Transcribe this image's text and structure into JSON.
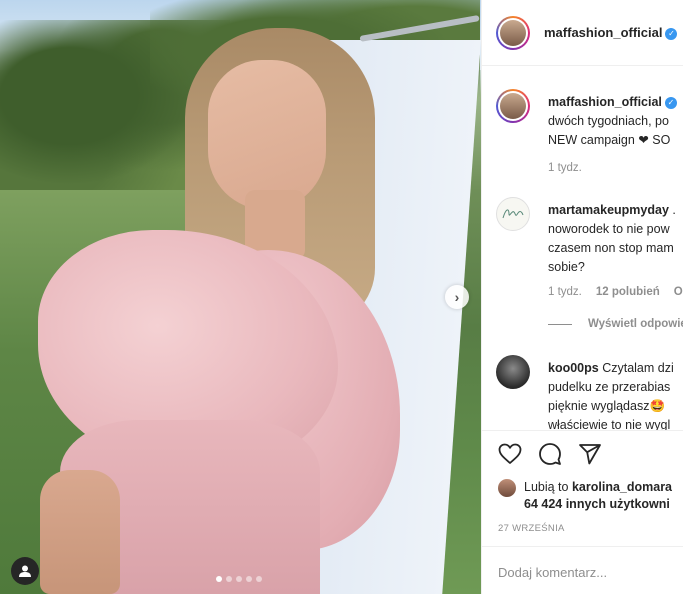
{
  "post": {
    "image_alt": "Woman in pink ruffled dress",
    "carousel_dots": 5,
    "active_dot": 0,
    "next_symbol": "›"
  },
  "header": {
    "username": "maffashion_official",
    "verified_symbol": "✓"
  },
  "comments": [
    {
      "username": "maffashion_official",
      "verified_symbol": "✓",
      "lines": [
        "dwóch tygodniach, po",
        "NEW campaign ❤ SO"
      ],
      "time": "1 tydz.",
      "likes": "",
      "reply": ""
    },
    {
      "username": "martamakeupmyday",
      "lines": [
        "noworodek to nie pow",
        "czasem non stop mam",
        "sobie?"
      ],
      "first_suffix": " .",
      "time": "1 tydz.",
      "likes": "12 polubień",
      "reply": "Od",
      "view_replies": "Wyświetl odpowie"
    },
    {
      "username": "koo00ps",
      "first_text": " Czytalam dzi",
      "lines": [
        "pudelku ze przerabias",
        "pięknie wyglądasz🤩",
        "właściewie to nie wygl"
      ]
    }
  ],
  "actions": {
    "icons": [
      "heart-icon",
      "comment-icon",
      "share-icon"
    ]
  },
  "likes": {
    "prefix": "Lubią to ",
    "user": "karolina_domara",
    "rest": "64 424 innych użytkowni"
  },
  "date": "27 WRZEŚNIA",
  "add_comment_placeholder": "Dodaj komentarz..."
}
